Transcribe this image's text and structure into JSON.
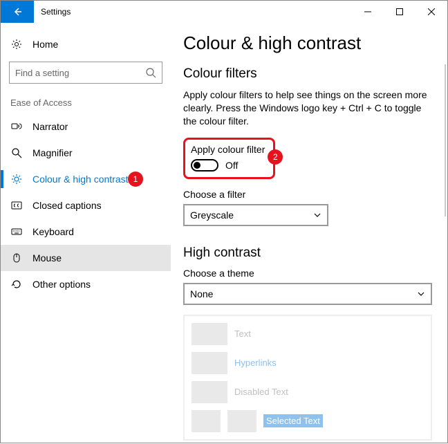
{
  "window": {
    "title": "Settings"
  },
  "sidebar": {
    "home_label": "Home",
    "search_placeholder": "Find a setting",
    "group_label": "Ease of Access",
    "items": [
      {
        "label": "Narrator"
      },
      {
        "label": "Magnifier"
      },
      {
        "label": "Colour & high contrast"
      },
      {
        "label": "Closed captions"
      },
      {
        "label": "Keyboard"
      },
      {
        "label": "Mouse"
      },
      {
        "label": "Other options"
      }
    ]
  },
  "main": {
    "page_title": "Colour & high contrast",
    "colour_filters": {
      "heading": "Colour filters",
      "description": "Apply colour filters to help see things on the screen more clearly. Press the Windows logo key + Ctrl + C to toggle the colour filter.",
      "toggle_label": "Apply colour filter",
      "toggle_state": "Off",
      "filter_label": "Choose a filter",
      "filter_value": "Greyscale"
    },
    "high_contrast": {
      "heading": "High contrast",
      "theme_label": "Choose a theme",
      "theme_value": "None",
      "preview": {
        "text": "Text",
        "hyperlinks": "Hyperlinks",
        "disabled": "Disabled Text",
        "selected": "Selected Text"
      }
    }
  },
  "annotations": {
    "badge1": "1",
    "badge2": "2"
  }
}
